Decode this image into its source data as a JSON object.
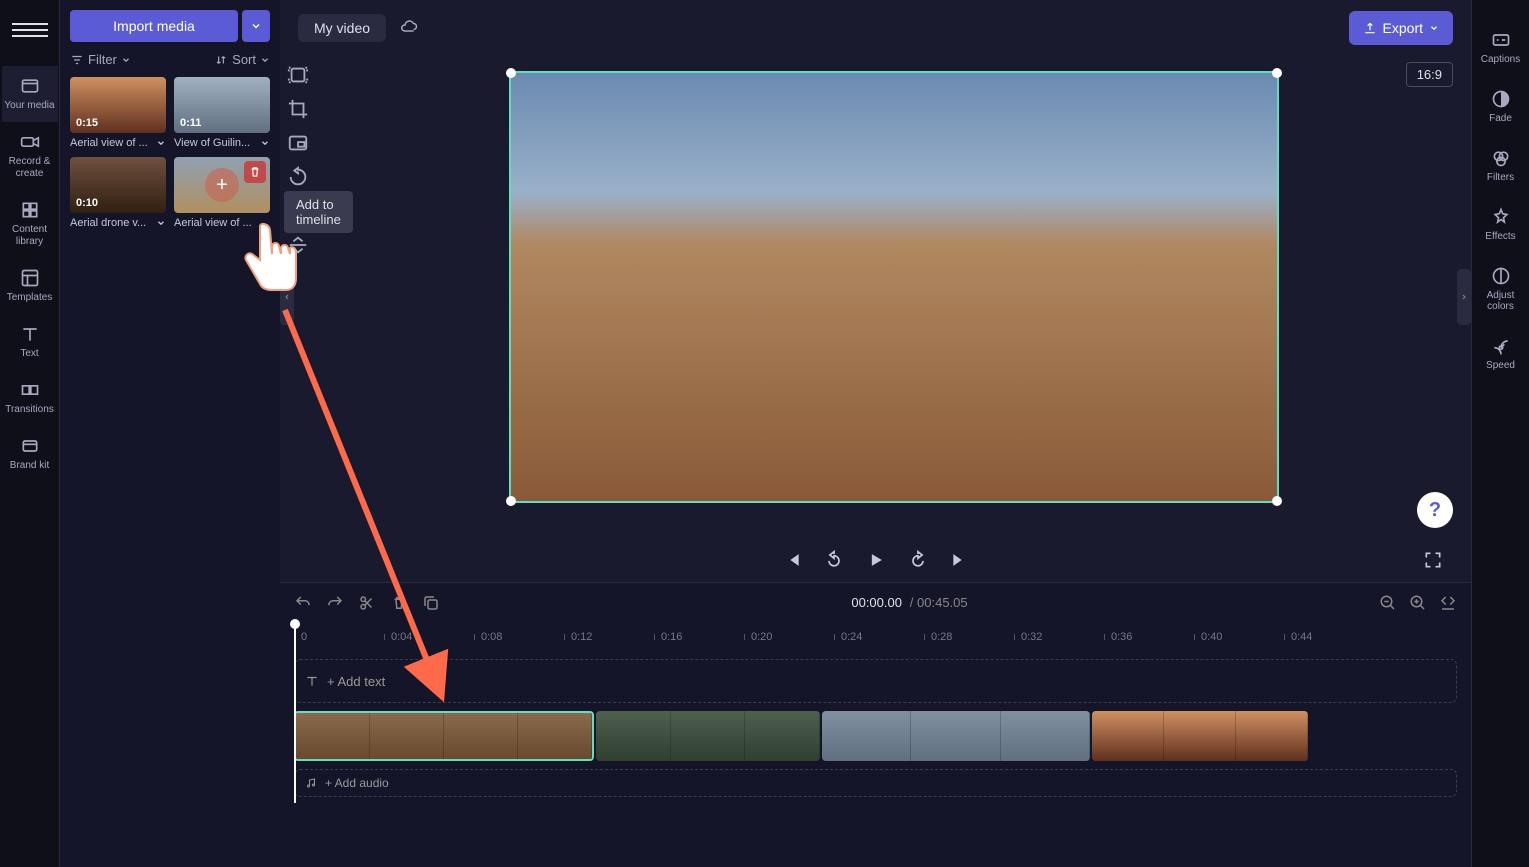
{
  "leftRail": {
    "items": [
      {
        "label": "Your media"
      },
      {
        "label": "Record & create"
      },
      {
        "label": "Content library"
      },
      {
        "label": "Templates"
      },
      {
        "label": "Text"
      },
      {
        "label": "Transitions"
      },
      {
        "label": "Brand kit"
      }
    ]
  },
  "mediaPanel": {
    "importLabel": "Import media",
    "filterLabel": "Filter",
    "sortLabel": "Sort",
    "items": [
      {
        "duration": "0:15",
        "name": "Aerial view of ..."
      },
      {
        "duration": "0:11",
        "name": "View of Guilin..."
      },
      {
        "duration": "0:10",
        "name": "Aerial drone v..."
      },
      {
        "duration": "",
        "name": "Aerial view of ..."
      }
    ],
    "tooltip": "Add to timeline"
  },
  "topBar": {
    "title": "My video",
    "exportLabel": "Export",
    "aspect": "16:9"
  },
  "player": {
    "currentTime": "00:00.00",
    "totalTime": "00:45.05"
  },
  "timeline": {
    "ruler": [
      "0",
      "0:04",
      "0:08",
      "0:12",
      "0:16",
      "0:20",
      "0:24",
      "0:28",
      "0:32",
      "0:36",
      "0:40",
      "0:44"
    ],
    "addTextLabel": "+ Add text",
    "addAudioLabel": "+ Add audio"
  },
  "rightRail": {
    "items": [
      {
        "label": "Captions"
      },
      {
        "label": "Fade"
      },
      {
        "label": "Filters"
      },
      {
        "label": "Effects"
      },
      {
        "label": "Adjust colors"
      },
      {
        "label": "Speed"
      }
    ]
  },
  "help": "?"
}
